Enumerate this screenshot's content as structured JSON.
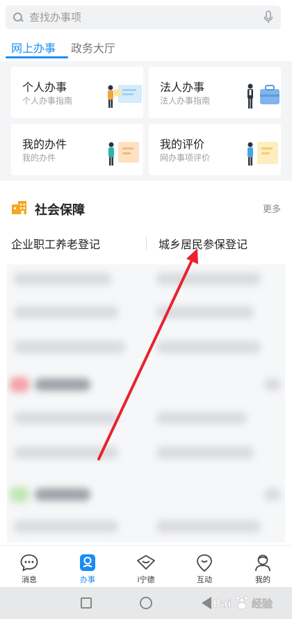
{
  "search": {
    "placeholder": "查找办事项",
    "mic_icon": "microphone-icon",
    "search_icon": "search-icon"
  },
  "tabs": [
    {
      "label": "网上办事",
      "active": true
    },
    {
      "label": "政务大厅",
      "active": false
    }
  ],
  "cards": [
    {
      "title": "个人办事",
      "subtitle": "个人办事指南"
    },
    {
      "title": "法人办事",
      "subtitle": "法人办事指南"
    },
    {
      "title": "我的办件",
      "subtitle": "我的办件"
    },
    {
      "title": "我的评价",
      "subtitle": "网办事项评价"
    }
  ],
  "section": {
    "title": "社会保障",
    "more": "更多",
    "icon": "building-icon"
  },
  "items": [
    "企业职工养老登记",
    "城乡居民参保登记"
  ],
  "bottom_nav": [
    {
      "label": "消息",
      "icon": "message-icon",
      "active": false
    },
    {
      "label": "办事",
      "icon": "affairs-icon",
      "active": true
    },
    {
      "label": "i宁德",
      "icon": "ningde-icon",
      "active": false
    },
    {
      "label": "互动",
      "icon": "interaction-icon",
      "active": false
    },
    {
      "label": "我的",
      "icon": "profile-icon",
      "active": false
    }
  ],
  "watermark": "Baidu 经验",
  "colors": {
    "accent": "#1c8cf4",
    "arrow": "#e8232e",
    "section_icon": "#f5a623"
  }
}
